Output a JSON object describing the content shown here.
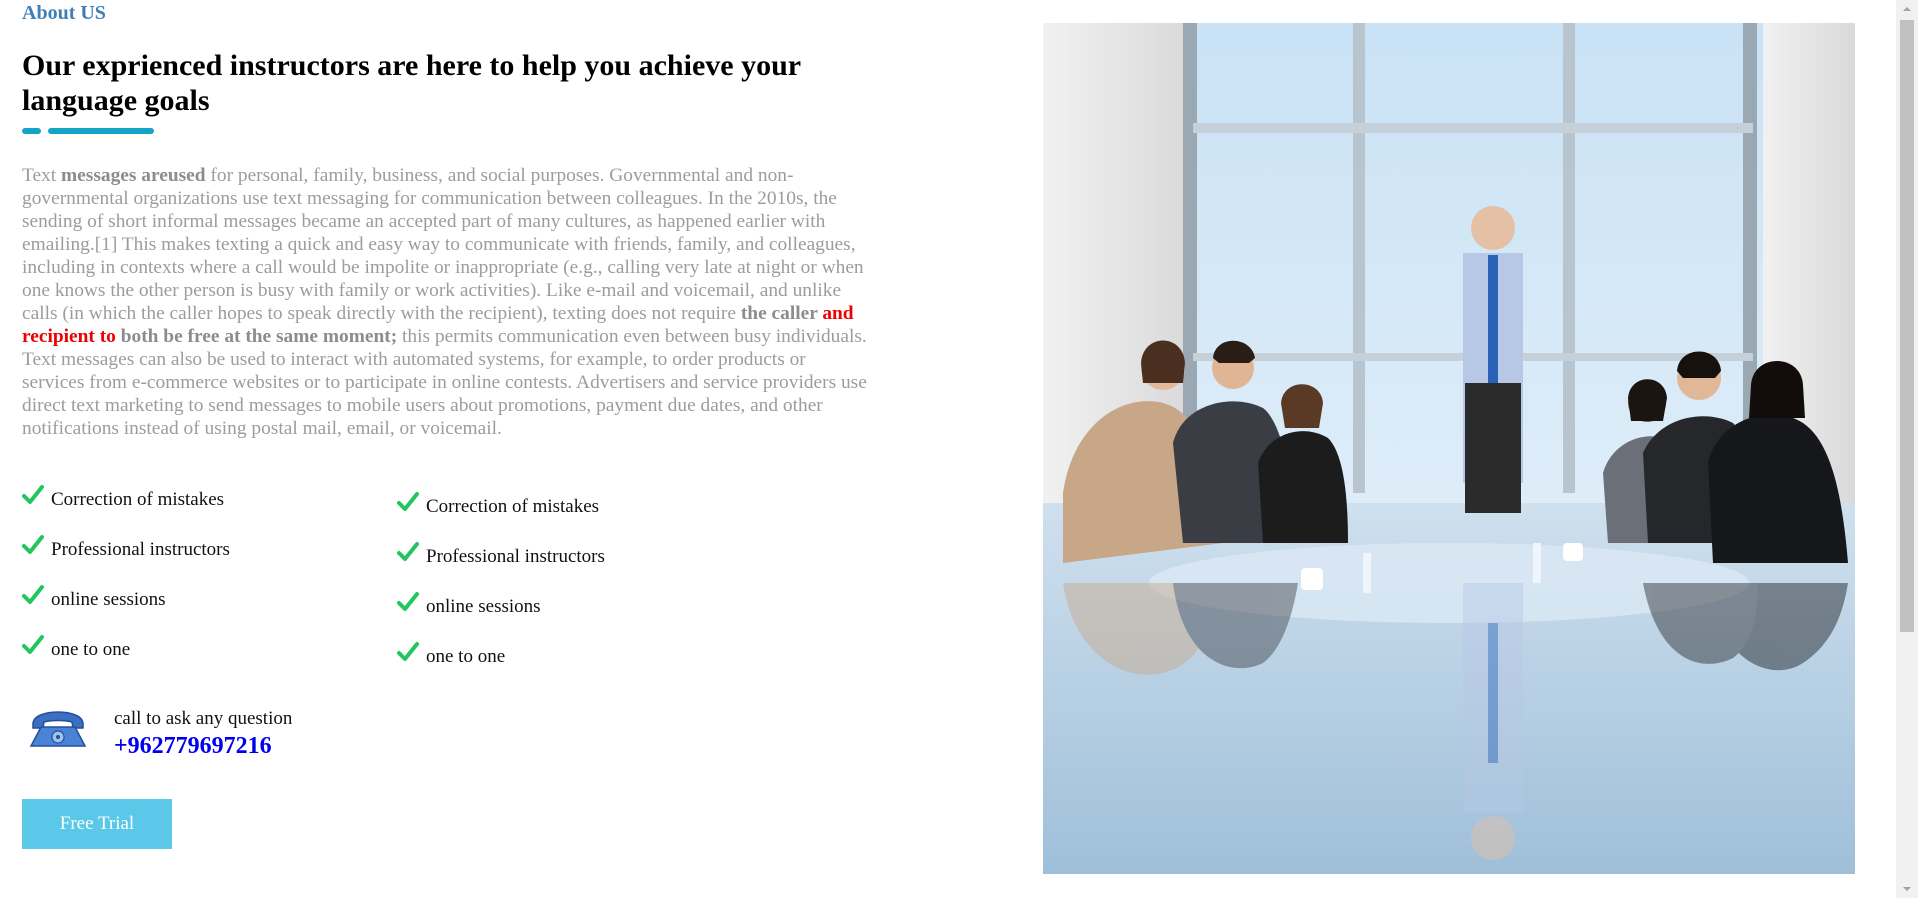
{
  "section_label": "About US",
  "headline": "Our exprienced instructors are here to help you achieve your language goals",
  "body": {
    "seg1": "Text ",
    "seg2_bold": "messages areused",
    "seg3": " for personal, family, business, and social purposes. Governmental and non-governmental organizations use text messaging for communication between colleagues. In the 2010s, the sending of short informal messages became an accepted part of many cultures, as happened earlier with emailing.[1] This makes texting a quick and easy way to communicate with friends, family, and colleagues, including in contexts where a call would be impolite or inappropriate (e.g., calling very late at night or when one knows the other person is busy with family or work activities). Like e-mail and voicemail, and unlike calls (in which the caller hopes to speak directly with the recipient), texting does not require ",
    "seg4_bold": "the caller ",
    "seg5_red": "and recipient to",
    "seg6_bold": " both be free at the same moment;",
    "seg7": " this permits communication even between busy individuals. Text messages can also be used to interact with automated systems, for example, to order products or services from e-commerce websites or to participate in online contests. Advertisers and service providers use direct text marketing to send messages to mobile users about promotions, payment due dates, and other notifications instead of using postal mail, email, or voicemail."
  },
  "features_col1": [
    "Correction of mistakes",
    "Professional instructors",
    "online sessions",
    "one to one"
  ],
  "features_col2": [
    "Correction of mistakes",
    "Professional instructors",
    "online sessions",
    "one to one"
  ],
  "call": {
    "text": "call to ask any question",
    "number": "+962779697216"
  },
  "free_trial_label": "Free Trial",
  "colors": {
    "accent": "#13a5c3",
    "check": "#22c55e",
    "button": "#5bc8ea",
    "link": "#0000ee",
    "section_label": "#3f7fb7",
    "highlight_red": "#ee0000"
  },
  "icons": [
    "check-icon",
    "telephone-icon"
  ],
  "image": "meeting-photo"
}
